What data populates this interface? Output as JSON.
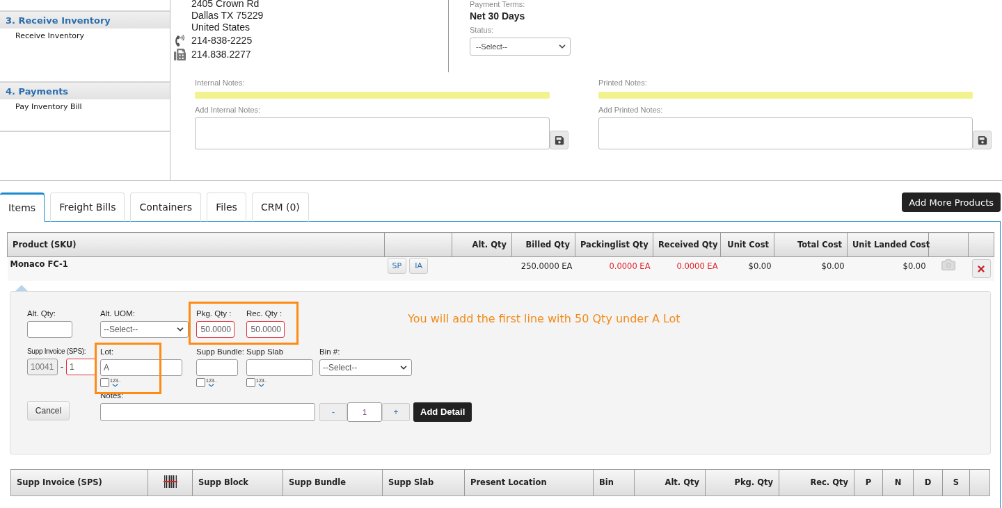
{
  "sidebar": {
    "sections": [
      {
        "title": "3. Receive Inventory",
        "items": [
          "Receive Inventory"
        ]
      },
      {
        "title": "4. Payments",
        "items": [
          "Pay Inventory Bill"
        ]
      }
    ]
  },
  "vendor": {
    "address_lines": [
      "2405 Crown Rd",
      "Dallas TX 75229",
      "United States"
    ],
    "phone": "214-838-2225",
    "fax": "214.838.2277"
  },
  "payment_terms": {
    "label": "Payment Terms:",
    "value": "Net 30 Days"
  },
  "status": {
    "label": "Status:",
    "value": "--Select--"
  },
  "notes": [
    {
      "label": "Internal Notes:",
      "add_label": "Add Internal Notes:"
    },
    {
      "label": "Printed Notes:",
      "add_label": "Add Printed Notes:"
    }
  ],
  "tabs": [
    {
      "label": "Items",
      "selected": true
    },
    {
      "label": "Freight Bills",
      "selected": false
    },
    {
      "label": "Containers",
      "selected": false
    },
    {
      "label": "Files",
      "selected": false
    },
    {
      "label": "CRM (0)",
      "selected": false
    }
  ],
  "add_products_button": "Add More Products",
  "items_table": {
    "columns": [
      "Product (SKU)",
      "Alt. Qty",
      "Billed Qty",
      "Packinglist Qty",
      "Received Qty",
      "Unit Cost",
      "Total Cost",
      "Unit Landed Cost"
    ],
    "rows": [
      {
        "product": "Monaco FC-1",
        "actions": [
          "SP",
          "IA"
        ],
        "billed_qty": {
          "text": "250.0000 EA",
          "warn": false
        },
        "packinglist_qty": {
          "text": "0.0000 EA",
          "warn": true
        },
        "received_qty": {
          "text": "0.0000 EA",
          "warn": true
        },
        "unit_cost": "$0.00",
        "total_cost": "$0.00",
        "unit_landed_cost": "$0.00"
      }
    ]
  },
  "detail": {
    "alt_qty": {
      "label": "Alt. Qty:"
    },
    "alt_uom": {
      "label": "Alt. UOM:",
      "value": "--Select--"
    },
    "pkg_qty": {
      "label": "Pkg. Qty :",
      "value": "50.0000",
      "invalid": true
    },
    "rec_qty": {
      "label": "Rec. Qty :",
      "value": "50.0000",
      "invalid": true
    },
    "supp_invoice": {
      "label": "Supp Invoice (SPS):",
      "prefix": "10041",
      "separator": "-",
      "value": "1",
      "invalid": true
    },
    "lot": {
      "label": "Lot:",
      "value": "A",
      "sequence_checked": false,
      "sequence_label": "123.."
    },
    "supp_bundle": {
      "label": "Supp Bundle:",
      "sequence_checked": false,
      "sequence_label": "123.."
    },
    "supp_slab": {
      "label": "Supp Slab",
      "sequence_checked": false,
      "sequence_label": "123.."
    },
    "bin": {
      "label": "Bin #:",
      "value": "--Select--"
    },
    "notes": {
      "label": "Notes:"
    },
    "cancel_button": "Cancel",
    "stepper": {
      "minus": "-",
      "value": "1",
      "plus": "+"
    },
    "add_button": "Add Detail",
    "annotation": "You will add the first line with 50 Qty under A Lot"
  },
  "details_table": {
    "columns": [
      {
        "kind": "text",
        "label": "Supp Invoice (SPS)"
      },
      {
        "kind": "icon"
      },
      {
        "kind": "text",
        "label": "Supp Block"
      },
      {
        "kind": "text",
        "label": "Supp Bundle"
      },
      {
        "kind": "text",
        "label": "Supp Slab"
      },
      {
        "kind": "text",
        "label": "Present Location"
      },
      {
        "kind": "text",
        "label": "Bin"
      },
      {
        "kind": "text",
        "label": "Alt. Qty"
      },
      {
        "kind": "text",
        "label": "Pkg. Qty"
      },
      {
        "kind": "text",
        "label": "Rec. Qty"
      },
      {
        "kind": "text",
        "label": "P"
      },
      {
        "kind": "text",
        "label": "N"
      },
      {
        "kind": "text",
        "label": "D"
      },
      {
        "kind": "text",
        "label": "S"
      }
    ]
  }
}
